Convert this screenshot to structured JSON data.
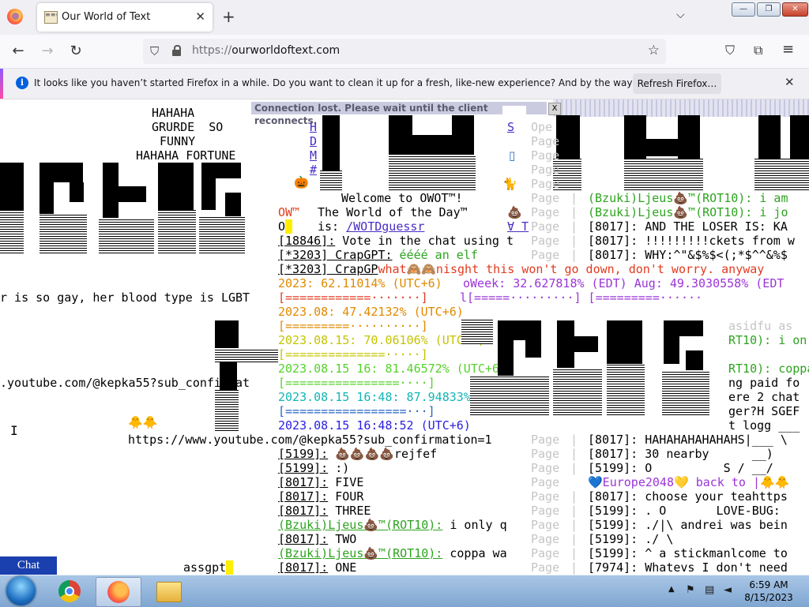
{
  "browser": {
    "tab_title": "Our World of Text",
    "tab_close": "✕",
    "new_tab": "+",
    "tab_list": "⌵",
    "window_minimize": "—",
    "window_maximize": "❐",
    "window_close": "✕",
    "back": "←",
    "forward": "→",
    "reload": "↻",
    "url_scheme": "https://",
    "url_host": "ourworldoftext.com",
    "bookmark": "☆",
    "pocket": "⛉",
    "extensions": "⧉",
    "menu": "≡",
    "notification_info": "i",
    "notification_text": "It looks like you haven’t started Firefox in a while. Do you want to clean it up for a fresh, like-new experience? And by the way, welcome back!",
    "refresh_button": "Refresh Firefox…",
    "notification_close": "✕"
  },
  "owot": {
    "connection_lost": "Connection lost. Please wait until the client reconnects.",
    "connection_close": "X",
    "chat_button": "Chat",
    "cursor": "I",
    "left": {
      "hahaha1": "HAHAHA",
      "grurde": "GRURDE  SO",
      "funny": "FUNNY",
      "fortune": "HAHAHA FORTUNE",
      "gay_line": "r is so gay, her blood type is LGBT",
      "yt1": ".youtube.com/@kepka55?sub_confirmat",
      "yt2": "https://www.youtube.com/@kepka55?sub_confirmation=1",
      "assgpt": "assgpt"
    },
    "menu_links": [
      "H",
      "D",
      "M",
      "#"
    ],
    "tile_menu": [
      "S",
      "▯",
      "🐈"
    ],
    "welcome": "Welcome to OWOT™!",
    "wotd_line1": "The World of the Day™",
    "wotd_line2_prefix": "is:",
    "wotd_link": "/WOTDguessr",
    "ow_mark": "OW™",
    "o_mark": "O",
    "pumpkin": "🎃",
    "poop": "💩",
    "chat_lines": [
      {
        "user": "[18846]:",
        "text": " Vote in the chat using t"
      },
      {
        "user": "[*3203] CrapGPT:",
        "text": " éééé an elf"
      },
      {
        "user": "[*3203] CrapGP",
        "text": "what🙈🙈nisght this won't go down, don't worry. anyway"
      }
    ],
    "progress": [
      {
        "label": "2023: 62.11014% (UTC+6)",
        "extra": "oWeek: 32.627818% (EDT) Aug: 49.3030558% (EDT"
      },
      {
        "label": "[============·······]",
        "extra": "l[=====·········] [=========······"
      },
      {
        "label": "2023.08: 47.42132% (UTC+6)"
      },
      {
        "label": "[=========··········]"
      },
      {
        "label": "2023.08.15: 70.06106% (UTC+6)"
      },
      {
        "label": "[==============·····]"
      },
      {
        "label": "2023.08.15 16: 81.46572% (UTC+6)"
      },
      {
        "label": "[================····]"
      },
      {
        "label": "2023.08.15 16:48: 87.94833% (UTC+6)"
      },
      {
        "label": "[=================···]"
      },
      {
        "label": "2023.08.15 16:48:52 (UTC+6)"
      }
    ],
    "bottom_chat": [
      {
        "user": "[5199]:",
        "text": " 💩💩💩💩rejfef"
      },
      {
        "user": "[5199]:",
        "text": " :)"
      },
      {
        "user": "[8017]:",
        "text": " FIVE"
      },
      {
        "user": "[8017]:",
        "text": " FOUR"
      },
      {
        "user": "[8017]:",
        "text": " THREE"
      },
      {
        "user": "(Bzuki)Ljeus💩™(ROT10):",
        "text": " i only q",
        "green": true
      },
      {
        "user": "[8017]:",
        "text": " TWO"
      },
      {
        "user": "(Bzuki)Ljeus💩™(ROT10):",
        "text": " coppa wa",
        "green": true
      },
      {
        "user": "[8017]:",
        "text": " ONE"
      }
    ],
    "page_word": "Page",
    "pipe": "|",
    "right_top": [
      "(Bzuki)Ljeus💩™(ROT10): i am",
      "(Bzuki)Ljeus💩™(ROT10): i jo",
      "[8017]: AND THE LOSER IS: KA",
      "[8017]: !!!!!!!!!ckets from w",
      "[8017]: WHY:^\"&$%$<(;*$^^&%$"
    ],
    "right_mid": [
      "asidfu as",
      "RT10): i on",
      "RT10): coppa",
      "ng paid fo",
      "ere 2 chat",
      "ger?H SGEF",
      "t logg ___"
    ],
    "right_bottom": [
      "[8017]: HAHAHAHAHAHAHS|___ \\",
      "[8017]: 30 nearby      __)",
      "[5199]: O          S / __/",
      "💙Europe2048💛 back to |🐥🐥",
      "[8017]: choose your teahttps",
      "[5199]: . O       LOVE-BUG: ",
      "[5199]: ./|\\ andrei was bein",
      "[5199]: ./ \\",
      "[5199]: ^ a stickmanlcome to",
      "[7974]: Whatevs I don't need"
    ],
    "left_faint": "Ope"
  },
  "taskbar": {
    "time": "6:59 AM",
    "date": "8/15/2023",
    "tray_arrow": "▲"
  }
}
